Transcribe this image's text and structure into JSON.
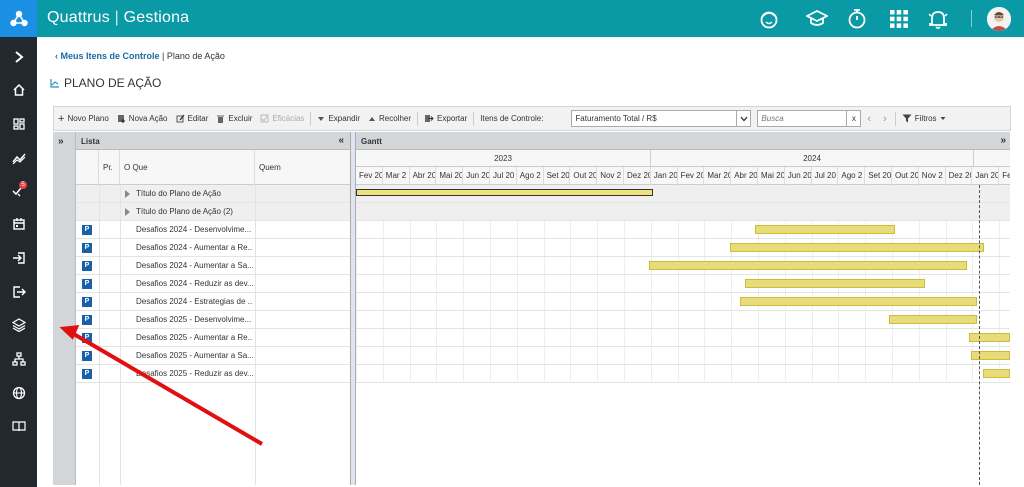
{
  "app": {
    "brand": "Quattrus",
    "module": "Gestiona"
  },
  "breadcrumb": {
    "back": "Meus Itens de Controle",
    "sep": "|",
    "current": "Plano de Ação"
  },
  "page_title": "PLANO DE AÇÃO",
  "toolbar": {
    "novo_plano": "Novo Plano",
    "nova_acao": "Nova Ação",
    "editar": "Editar",
    "excluir": "Excluir",
    "eficacias": "Eficácias",
    "expandir": "Expandir",
    "recolher": "Recolher",
    "exportar": "Exportar",
    "itens_label": "Itens de Controle:",
    "itens_value": "Faturamento Total / R$",
    "busca_placeholder": "Busca",
    "clear": "x",
    "filtros": "Filtros"
  },
  "list": {
    "title": "Lista",
    "collapse": "«",
    "expand": "»",
    "columns": {
      "priority": "Pr.",
      "what": "O Que",
      "who": "Quem"
    },
    "rows": [
      {
        "what": "Título do Plano de Ação",
        "group": true
      },
      {
        "what": "Título do Plano de Ação (2)",
        "group": true
      },
      {
        "what": "Desafios 2024 - Desenvolvime...",
        "icon": "P"
      },
      {
        "what": "Desafios 2024 - Aumentar a Re...",
        "icon": "P"
      },
      {
        "what": "Desafios 2024 - Aumentar a Sa...",
        "icon": "P"
      },
      {
        "what": "Desafios 2024 - Reduzir as dev...",
        "icon": "P"
      },
      {
        "what": "Desafios 2024 - Estrategias de ...",
        "icon": "P"
      },
      {
        "what": "Desafios 2025 - Desenvolvime...",
        "icon": "P"
      },
      {
        "what": "Desafios 2025 - Aumentar a Re...",
        "icon": "P"
      },
      {
        "what": "Desafios 2025 - Aumentar a Sa...",
        "icon": "P"
      },
      {
        "what": "Desafios 2025 - Reduzir as dev...",
        "icon": "P"
      }
    ]
  },
  "gantt": {
    "title": "Gantt",
    "expand": "»",
    "years": [
      "2023",
      "2024"
    ],
    "months_2023": [
      "Fev 20",
      "Mar 2",
      "Abr 20",
      "Mai 20",
      "Jun 20",
      "Jul 20",
      "Ago 2",
      "Set 20",
      "Out 20",
      "Nov 2",
      "Dez 20"
    ],
    "months_2024": [
      "Jan 20",
      "Fev 20",
      "Mar 20",
      "Abr 20",
      "Mai 20",
      "Jun 20",
      "Jul 20",
      "Ago 2",
      "Set 20",
      "Out 20",
      "Nov 2",
      "Dez 20"
    ],
    "months_2025": [
      "Jan 20",
      "Fe"
    ]
  },
  "colors": {
    "topbar": "#0a9aa5",
    "sidebar": "#22282e",
    "logo_bg": "#1b8fe3",
    "bar": "#e8dc7a",
    "icon_blue": "#1a5fa8",
    "annotation_arrow": "#e01010"
  },
  "sidebar": {
    "notification_count": "5"
  },
  "icons": {
    "sidebar": [
      "chevron-right-icon",
      "home-icon",
      "dashboard-icon",
      "chart-icon",
      "checklist-icon",
      "calendar-icon",
      "login-icon",
      "logout-icon",
      "layers-icon",
      "hierarchy-icon",
      "globe-icon",
      "book-icon"
    ],
    "topbar": [
      "support-icon",
      "graduation-cap-icon",
      "stopwatch-icon",
      "apps-grid-icon",
      "bell-icon",
      "user-avatar"
    ]
  }
}
